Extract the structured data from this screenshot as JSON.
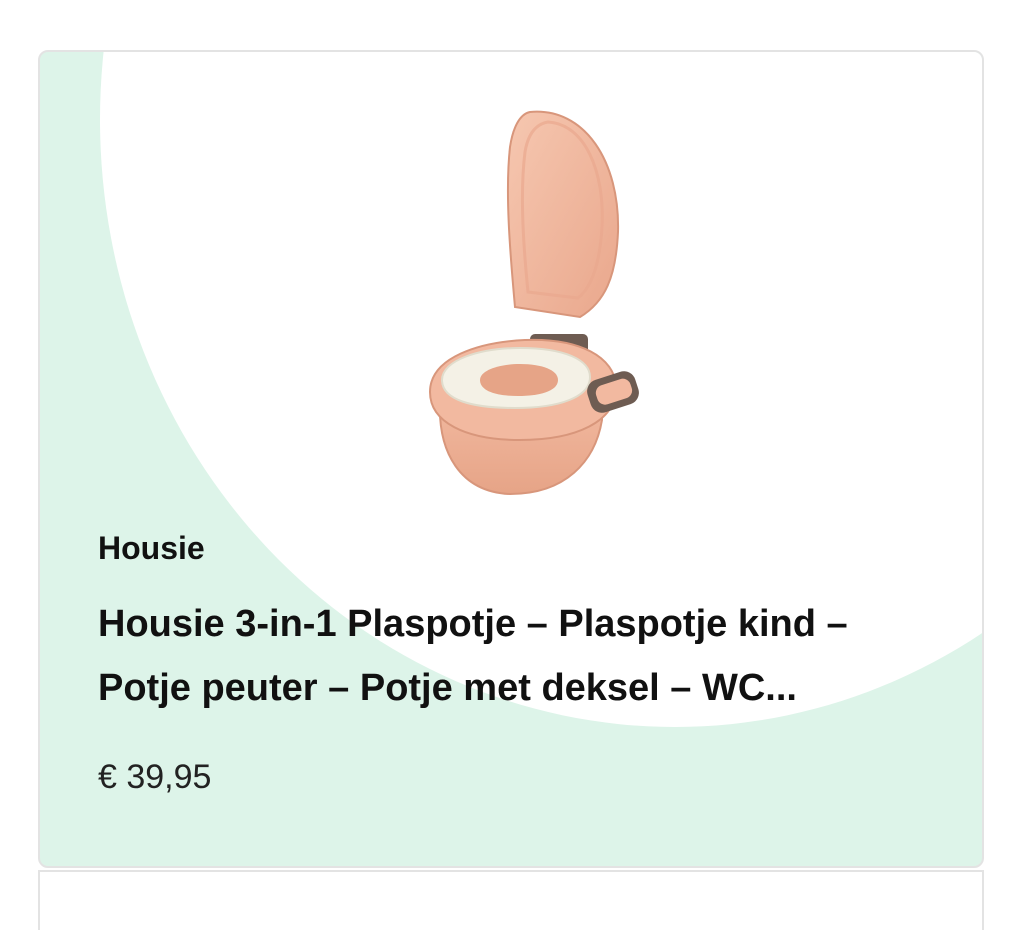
{
  "product": {
    "brand": "Housie",
    "title": "Housie 3-in-1 Plaspotje – Plaspotje kind – Potje peuter – Potje met deksel – WC...",
    "price": "€ 39,95",
    "image_icon": "potty-image",
    "colors": {
      "card_accent": "#ddf4e9",
      "potty_body": "#f2b9a0",
      "potty_seat": "#f4f1e6",
      "potty_handle": "#6e5c52"
    }
  }
}
